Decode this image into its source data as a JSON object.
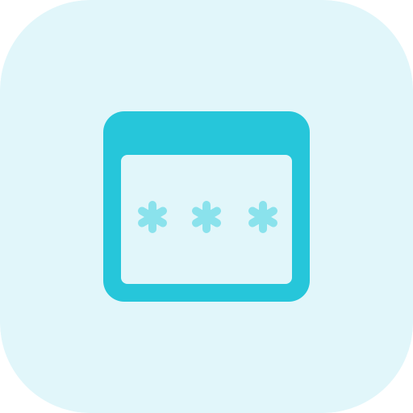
{
  "icon": {
    "name": "password-window-icon",
    "glyphs": [
      "asterisk-icon",
      "asterisk-icon",
      "asterisk-icon"
    ]
  },
  "colors": {
    "tile_background": "#e1f6fa",
    "window_frame": "#26c6da",
    "window_body": "#e1f6fa",
    "asterisk": "#8ae2ec"
  }
}
